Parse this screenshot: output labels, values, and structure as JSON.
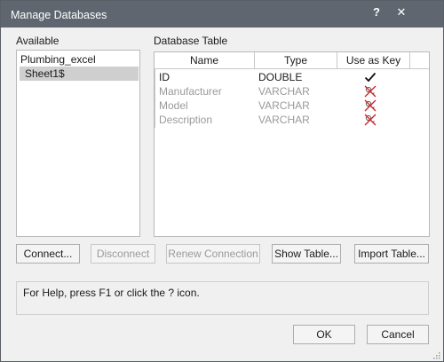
{
  "window": {
    "title": "Manage Databases",
    "help_glyph": "?",
    "close_glyph": "✕"
  },
  "available": {
    "label": "Available",
    "items": [
      {
        "label": "Plumbing_excel",
        "selected": false
      },
      {
        "label": "Sheet1$",
        "selected": true
      }
    ]
  },
  "database_table": {
    "label": "Database Table",
    "columns": [
      "Name",
      "Type",
      "Use as Key"
    ],
    "rows": [
      {
        "name": "ID",
        "type": "DOUBLE",
        "key_icon": "checkmark-icon",
        "enabled": true
      },
      {
        "name": "Manufacturer",
        "type": "VARCHAR",
        "key_icon": "key-crossed-icon",
        "enabled": false
      },
      {
        "name": "Model",
        "type": "VARCHAR",
        "key_icon": "key-crossed-icon",
        "enabled": false
      },
      {
        "name": "Description",
        "type": "VARCHAR",
        "key_icon": "key-crossed-icon",
        "enabled": false
      }
    ]
  },
  "buttons": {
    "connect": "Connect...",
    "disconnect": "Disconnect",
    "renew": "Renew Connection",
    "show_table": "Show Table...",
    "import_table": "Import Table...",
    "ok": "OK",
    "cancel": "Cancel"
  },
  "help": {
    "text": "For Help, press F1 or click the ? icon."
  },
  "colors": {
    "titlebar": "#5f6670",
    "dialog_bg": "#f0f0f0",
    "selection": "#cfcfcf",
    "disabled_text": "#9a9a9a",
    "crossed_key_red": "#d02020"
  }
}
